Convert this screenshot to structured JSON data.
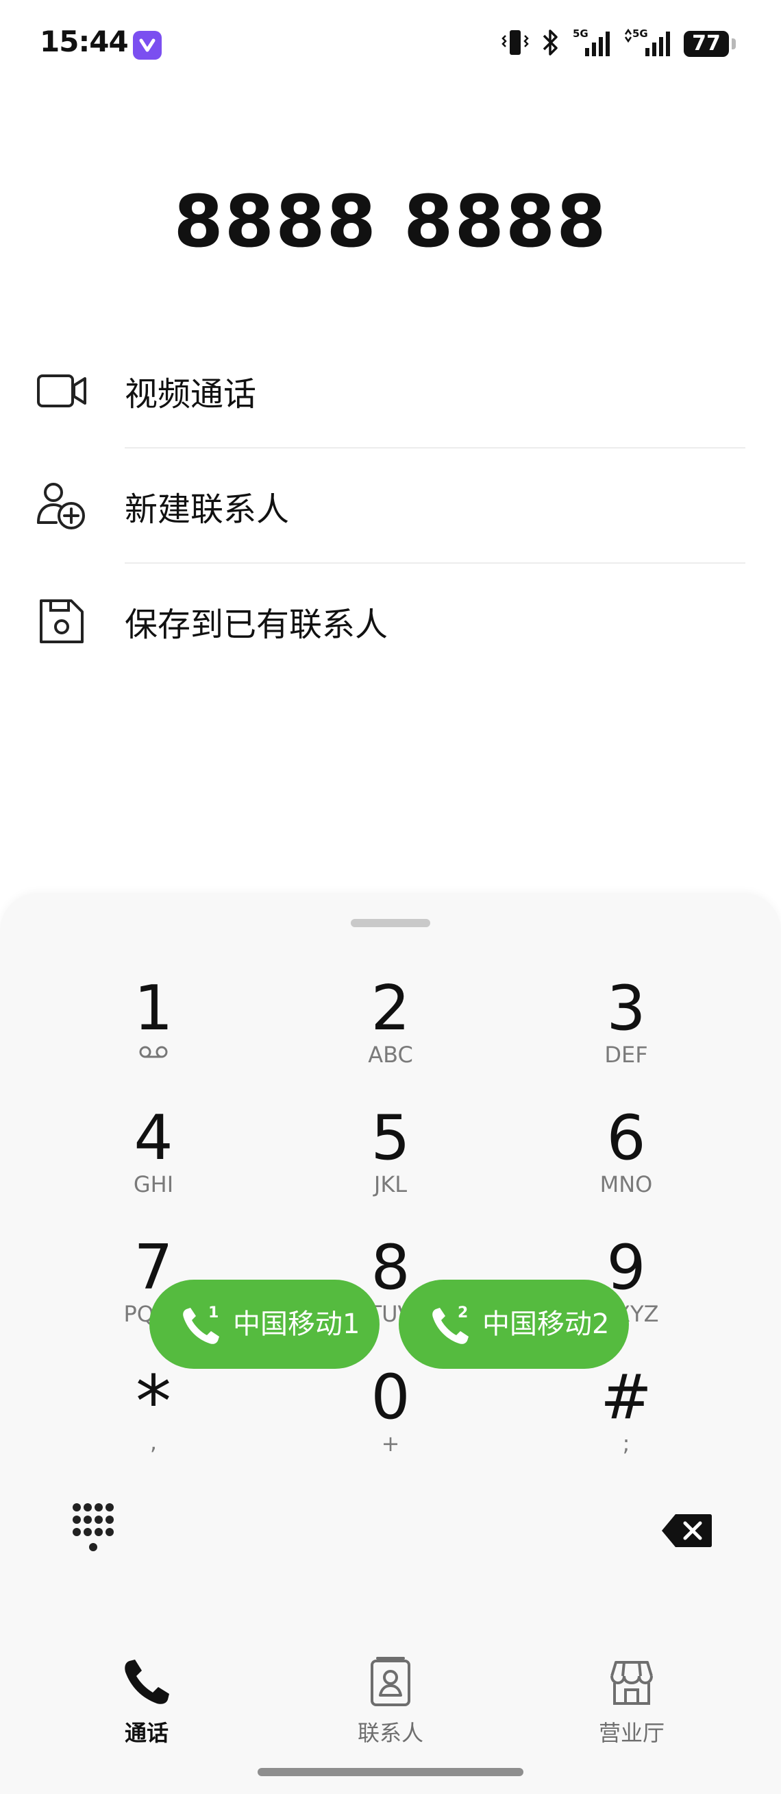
{
  "status_bar": {
    "time": "15:44",
    "app_badge_icon": "voice-message-app-icon",
    "icons": [
      "vibrate-icon",
      "bluetooth-icon",
      "5g-signal-icon",
      "5g-signal-icon"
    ],
    "network1": "5G",
    "network2": "5G",
    "battery": "77"
  },
  "dialed_number": "8888 8888",
  "actions": [
    {
      "label": "视频通话",
      "icon": "video-camera-icon"
    },
    {
      "label": "新建联系人",
      "icon": "add-contact-icon"
    },
    {
      "label": "保存到已有联系人",
      "icon": "save-icon"
    }
  ],
  "dialpad": {
    "keys": [
      {
        "digit": "1",
        "letters": "",
        "sub_icon": "voicemail-icon"
      },
      {
        "digit": "2",
        "letters": "ABC"
      },
      {
        "digit": "3",
        "letters": "DEF"
      },
      {
        "digit": "4",
        "letters": "GHI"
      },
      {
        "digit": "5",
        "letters": "JKL"
      },
      {
        "digit": "6",
        "letters": "MNO"
      },
      {
        "digit": "7",
        "letters": "PQRS"
      },
      {
        "digit": "8",
        "letters": "TUV"
      },
      {
        "digit": "9",
        "letters": "WXYZ"
      },
      {
        "digit": "*",
        "letters": ","
      },
      {
        "digit": "0",
        "letters": "+"
      },
      {
        "digit": "#",
        "letters": ";"
      }
    ],
    "sim1": {
      "label": "中国移动1",
      "badge": "1"
    },
    "sim2": {
      "label": "中国移动2",
      "badge": "2"
    }
  },
  "bottom_nav": [
    {
      "label": "通话",
      "icon": "phone-icon",
      "active": true
    },
    {
      "label": "联系人",
      "icon": "contacts-icon",
      "active": false
    },
    {
      "label": "营业厅",
      "icon": "store-icon",
      "active": false
    }
  ],
  "colors": {
    "accent_green": "#55bb3f",
    "app_badge_purple": "#7b4ff0",
    "sheet_background": "#f8f8f8",
    "text_primary": "#111111",
    "text_secondary": "#7a7a7a"
  }
}
